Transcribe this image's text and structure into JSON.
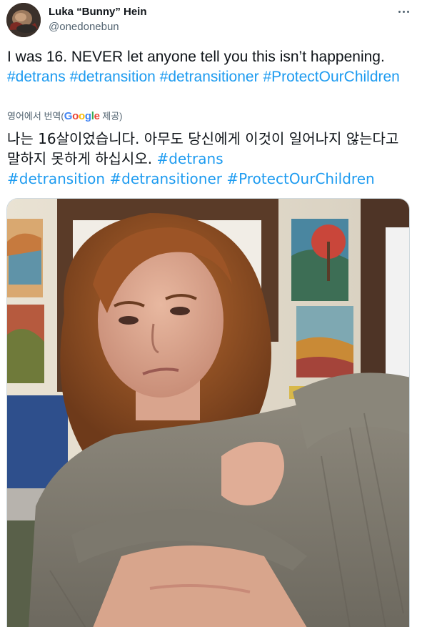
{
  "author": {
    "display_name": "Luka “Bunny” Hein",
    "handle": "@onedonebun"
  },
  "tweet": {
    "text_plain_1": "I was 16. NEVER let anyone tell you this isn’t happening. ",
    "hashtags": [
      "#detrans",
      "#detransition",
      "#detransitioner",
      "#ProtectOurChildren"
    ]
  },
  "translation": {
    "label_prefix": "영어에서 번역(",
    "google_letters": [
      "G",
      "o",
      "o",
      "g",
      "l",
      "e"
    ],
    "label_suffix": " 제공)",
    "text_plain": "나는 16살이었습니다. 아무도 당신에게 이것이 일어나지 않는다고 말하지 못하게 하십시오. ",
    "hashtags": [
      "#detrans",
      "#detransition",
      "#detransitioner",
      "#ProtectOurChildren"
    ]
  },
  "colors": {
    "link": "#1d9bf0",
    "secondary_text": "#536471",
    "primary_text": "#0f1419"
  },
  "icons": {
    "more": "more-horizontal-icon"
  }
}
